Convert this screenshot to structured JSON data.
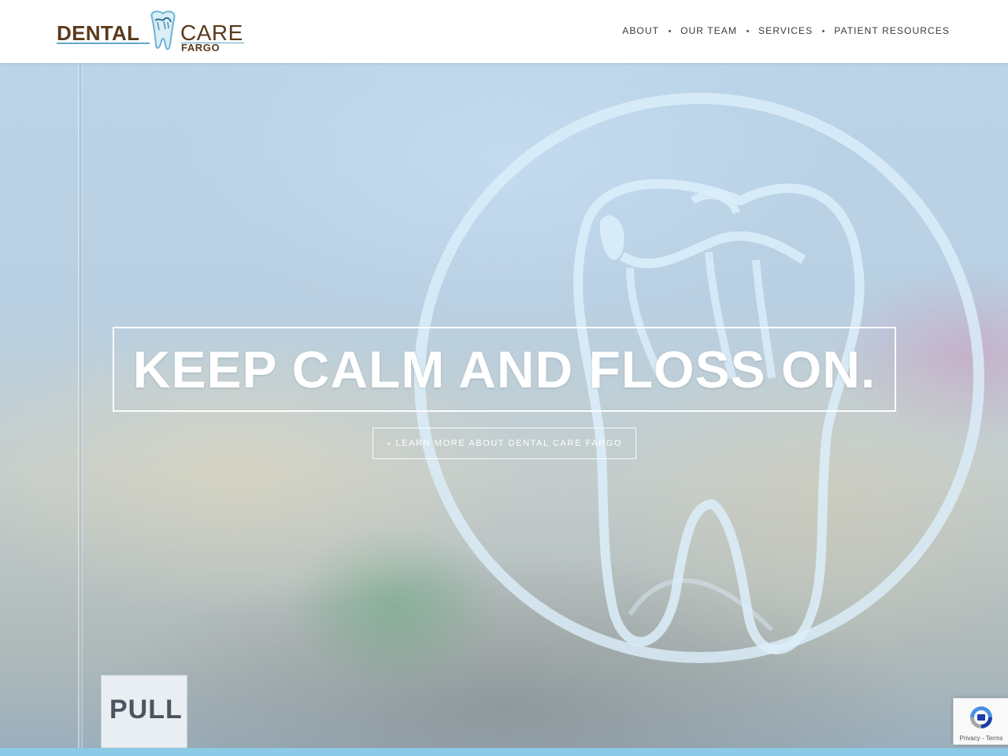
{
  "brand": {
    "name_part1": "DENTAL",
    "name_part2": "CARE",
    "name_part3": "FARGO",
    "logo_icon": "tooth-icon",
    "colors": {
      "brown": "#5a3a1c",
      "blue": "#5fa8c9"
    }
  },
  "nav": {
    "items": [
      {
        "label": "ABOUT"
      },
      {
        "label": "OUR TEAM"
      },
      {
        "label": "SERVICES"
      },
      {
        "label": "PATIENT RESOURCES"
      }
    ]
  },
  "hero": {
    "headline": "KEEP CALM AND FLOSS ON.",
    "cta_label": "LEARN MORE ABOUT DENTAL CARE FARGO",
    "cta_icon": "double-chevron-down-icon",
    "door_sign": "PULL",
    "decal_icon": "tooth-decal-icon"
  },
  "recaptcha": {
    "icon": "recaptcha-icon",
    "privacy": "Privacy",
    "separator": " - ",
    "terms": "Terms"
  }
}
